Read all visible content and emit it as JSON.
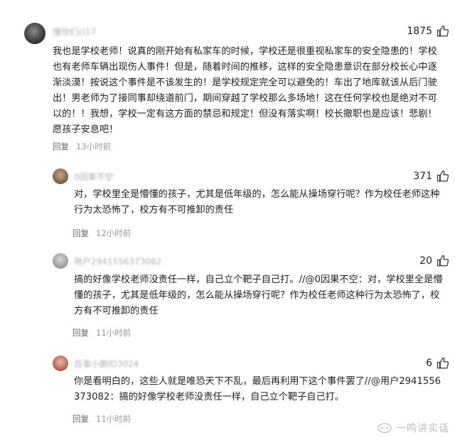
{
  "comments": [
    {
      "username": "懂你们ci17",
      "likes": "1875",
      "text": "我也是学校老师！说真的刚开始有私家车的时候，学校还是很重视私家车的安全隐患的！学校也有老师车辆出现伤人事件！但是，随着时间的推移，这样的安全隐患意识在部分校长心中逐渐淡漠！按说这个事件是不该发生的！是学校规定完全可以避免的！车出了地库就该从后门驶出！男老师为了接同事却绕道前门，期间穿越了学校那么多场地！这在任何学校也是绝对不可以的！！我想，学校一定有这方面的禁忌和规定！但没有落实啊！校长撤职也是应该！悲剧！愿孩子安息吧！",
      "reply_label": "回复",
      "time": "13小时前"
    },
    {
      "username": "0因果不空",
      "likes": "371",
      "text": "对，学校里全是懵懂的孩子，尤其是低年级的，怎么能从操场穿行呢？作为校任老师这种行为太恐怖了，校方有不可推卸的责任",
      "reply_label": "回复",
      "time": "12小时前"
    },
    {
      "username": "用户2941556373082",
      "likes": "20",
      "text": "搞的好像学校老师没责任一样，自己立个靶子自己打。//@0因果不空：对，学校里全是懵懂的孩子，尤其是低年级的，怎么能从操场穿行呢？作为校任老师这种行为太恐怖了，校方有不可推卸的责任",
      "reply_label": "回复",
      "time": "11小时前"
    },
    {
      "username": "百事小鹅ID3024",
      "likes": "6",
      "text": "你是看明白的，这些人就是唯恐天下不乱，最后再利用下这个事件罢了//@用户2941556373082：搞的好像学校老师没责任一样，自己立个靶子自己打。",
      "reply_label": "回复",
      "time": "11小时前"
    }
  ],
  "watermark": "一鸣讲实话",
  "icons": {
    "like": "thumbs-up-icon",
    "avatar": "avatar"
  },
  "colors": {
    "meta": "#999999",
    "text": "#222222"
  }
}
